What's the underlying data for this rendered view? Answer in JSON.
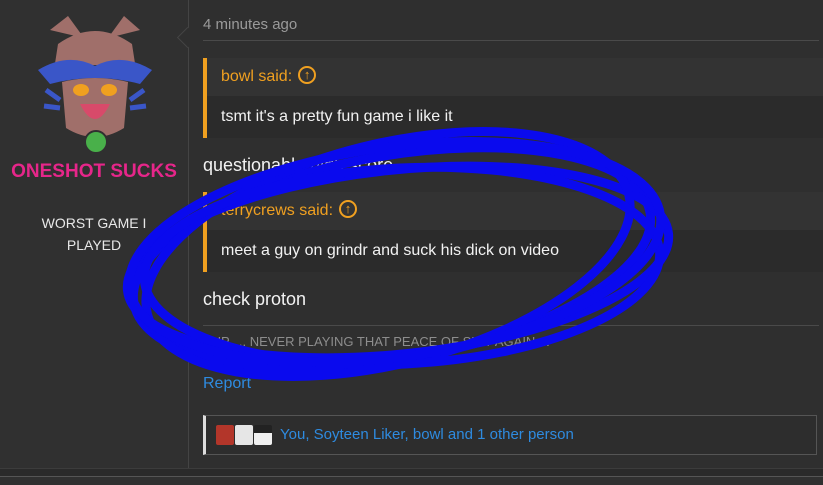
{
  "user": {
    "name": "ONESHOT SUCKS",
    "title": "WORST GAME I\nPLAYED",
    "online_color": "#49b04a",
    "name_color": "#e6268a"
  },
  "post": {
    "timestamp": "4 minutes ago",
    "quote1": {
      "author": "bowl said:",
      "body": "tsmt it's a pretty fun game i like it"
    },
    "text1": "questionable high score",
    "quote2": {
      "author": "terrycrews said:",
      "body": "meet a guy on grindr and suck his dick on video"
    },
    "text2": "check proton",
    "signature": "YUP..... NEVER PLAYING THAT PEACE OF SHIT AGAIN....",
    "report_label": "Report",
    "likes_text": "You, Soyteen Liker, bowl and 1 other person"
  },
  "colors": {
    "accent_quote": "#f0a020",
    "link": "#2e8be0",
    "scribble": "#0a0aee"
  }
}
